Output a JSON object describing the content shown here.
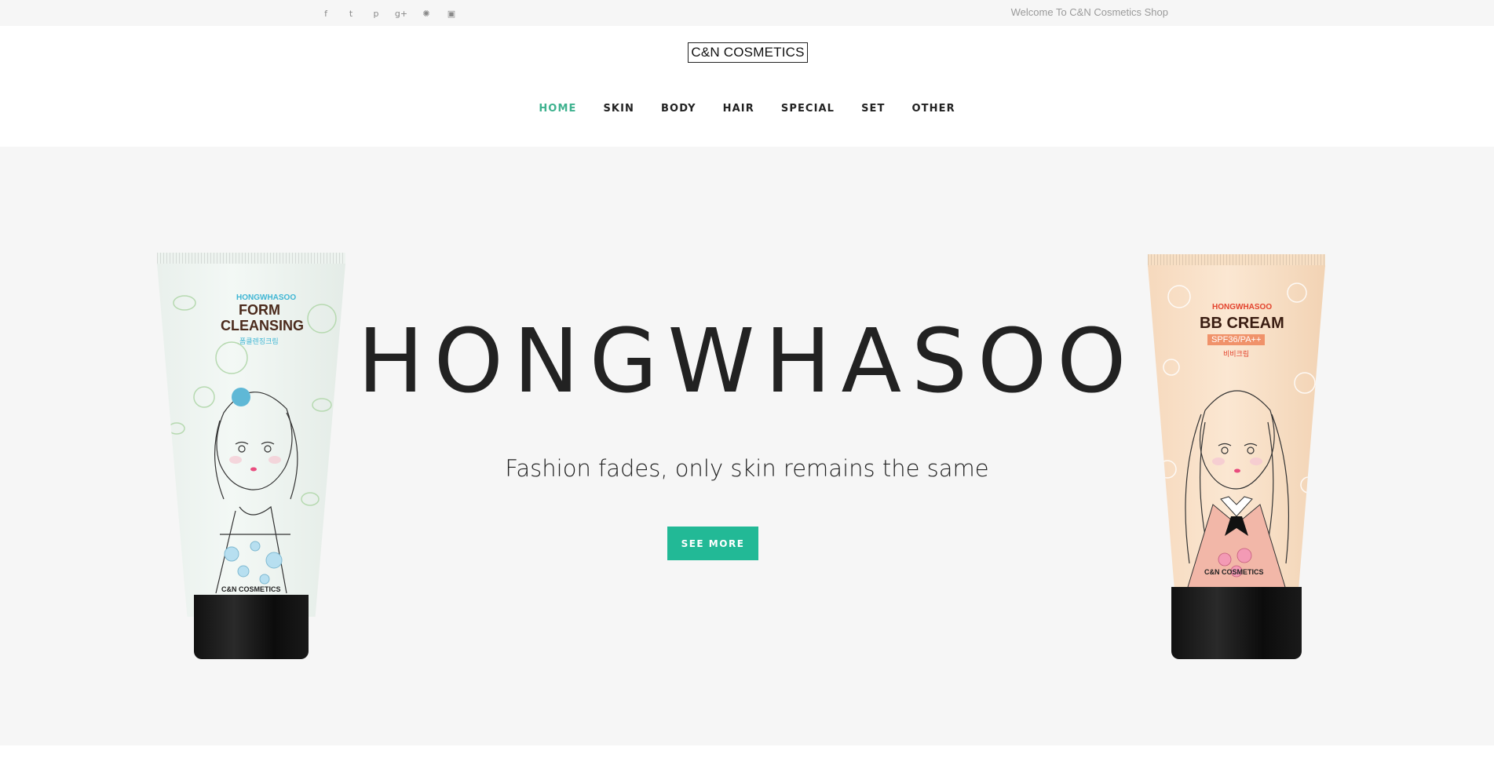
{
  "topbar": {
    "social_icons": [
      "facebook-icon",
      "twitter-icon",
      "pinterest-icon",
      "google-plus-icon",
      "dribbble-icon",
      "instagram-icon"
    ],
    "social_glyphs": [
      "f",
      "t",
      "p",
      "g+",
      "✺",
      "▣"
    ],
    "welcome": "Welcome To C&N Cosmetics Shop"
  },
  "header": {
    "logo": "C&N COSMETICS",
    "nav": [
      {
        "label": "HOME",
        "active": true
      },
      {
        "label": "SKIN",
        "active": false
      },
      {
        "label": "BODY",
        "active": false
      },
      {
        "label": "HAIR",
        "active": false
      },
      {
        "label": "SPECIAL",
        "active": false
      },
      {
        "label": "SET",
        "active": false
      },
      {
        "label": "OTHER",
        "active": false
      }
    ]
  },
  "hero": {
    "title": "HONGWHASOO",
    "subtitle": "Fashion fades, only skin remains the same",
    "button": "SEE MORE",
    "products": {
      "left": {
        "brand": "HONGWHASOO",
        "name_line1": "FORM",
        "name_line2": "CLEANSING",
        "korean": "폼클렌징크림",
        "maker": "C&N COSMETICS"
      },
      "right": {
        "brand": "HONGWHASOO",
        "name": "BB CREAM",
        "spf": "SPF36/PA++",
        "korean": "비비크림",
        "maker": "C&N COSMETICS"
      }
    }
  },
  "colors": {
    "accent": "#22b996",
    "nav_active": "#3fb28f",
    "hero_bg": "#f6f6f6"
  }
}
